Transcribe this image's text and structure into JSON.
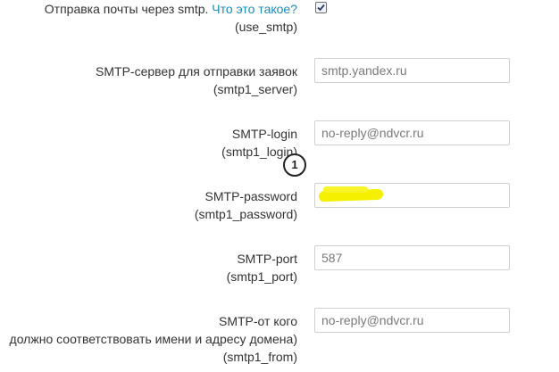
{
  "use_smtp": {
    "label": "Отправка почты через smtp.",
    "link": "Что это такое?",
    "code": "(use_smtp)",
    "checked": true
  },
  "server": {
    "label": "SMTP-сервер для отправки заявок",
    "code": "(smtp1_server)",
    "value": "smtp.yandex.ru"
  },
  "login": {
    "label": "SMTP-login",
    "code": "(smtp1_login)",
    "value": "no-reply@ndvcr.ru"
  },
  "password": {
    "label": "SMTP-password",
    "code": "(smtp1_password)"
  },
  "port": {
    "label": "SMTP-port",
    "code": "(smtp1_port)",
    "value": "587"
  },
  "from": {
    "label": "SMTP-от кого",
    "note": "должно соответствовать имени и адресу домена)",
    "code": "(smtp1_from)",
    "value": "no-reply@ndvcr.ru"
  },
  "callout": {
    "number": "1"
  },
  "colors": {
    "link": "#1a8ab8",
    "highlight": "#f4f000"
  }
}
